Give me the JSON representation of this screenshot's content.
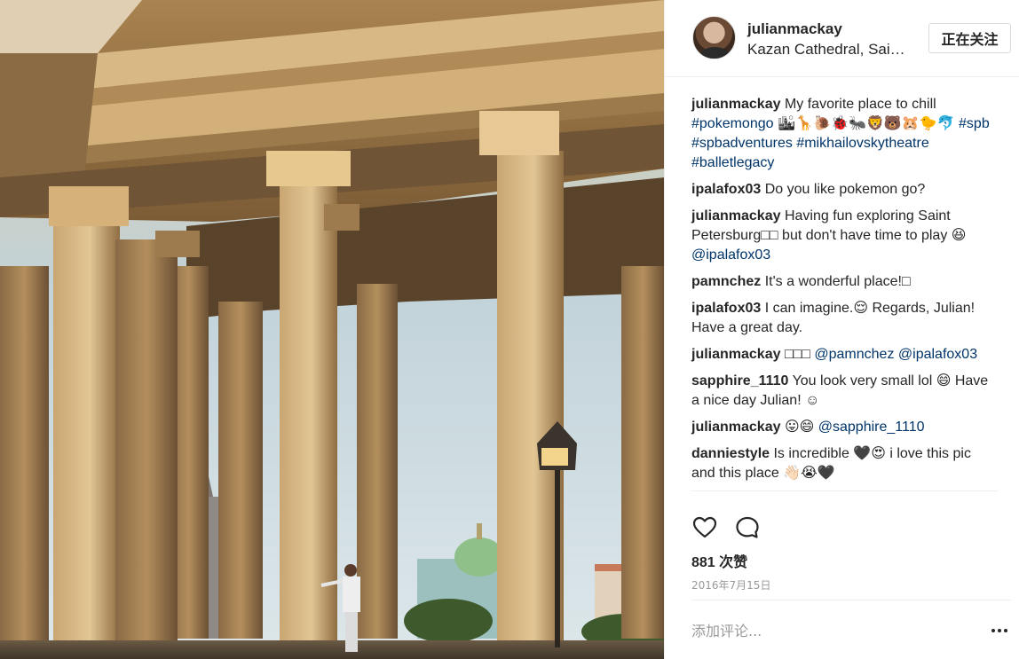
{
  "post": {
    "photo_icon": "colonnade-photo",
    "author": {
      "username": "julianmackay",
      "location": "Kazan Cathedral, Saint Petersburg",
      "avatar_icon": "profile-avatar-icon"
    },
    "follow_button_label": "正在关注",
    "comments": [
      {
        "user": "julianmackay",
        "parts": [
          {
            "t": "text",
            "v": "My favorite place to chill "
          },
          {
            "t": "tag",
            "v": "#pokemongo"
          },
          {
            "t": "text",
            "v": " 🏙🦒🐌🐞🐜🦁🐻🐹🐤🐬 "
          },
          {
            "t": "tag",
            "v": "#spb"
          },
          {
            "t": "text",
            "v": " "
          },
          {
            "t": "tag",
            "v": "#spbadventures"
          },
          {
            "t": "text",
            "v": " "
          },
          {
            "t": "tag",
            "v": "#mikhailovskytheatre"
          },
          {
            "t": "text",
            "v": " "
          },
          {
            "t": "tag",
            "v": "#balletlegacy"
          }
        ]
      },
      {
        "user": "ipalafox03",
        "parts": [
          {
            "t": "text",
            "v": "Do you like pokemon go?"
          }
        ]
      },
      {
        "user": "julianmackay",
        "parts": [
          {
            "t": "text",
            "v": "Having fun exploring Saint Petersburg□□ but don't have time to play 😆 "
          },
          {
            "t": "tag",
            "v": "@ipalafox03"
          }
        ]
      },
      {
        "user": "pamnchez",
        "parts": [
          {
            "t": "text",
            "v": "It's a wonderful place!□"
          }
        ]
      },
      {
        "user": "ipalafox03",
        "parts": [
          {
            "t": "text",
            "v": "I can imagine.😌 Regards, Julian! Have a great day."
          }
        ]
      },
      {
        "user": "julianmackay",
        "parts": [
          {
            "t": "text",
            "v": "□□□ "
          },
          {
            "t": "tag",
            "v": "@pamnchez"
          },
          {
            "t": "text",
            "v": " "
          },
          {
            "t": "tag",
            "v": "@ipalafox03"
          }
        ]
      },
      {
        "user": "sapphire_1110",
        "parts": [
          {
            "t": "text",
            "v": "You look very small lol 😄 Have a nice day Julian! ☺"
          }
        ]
      },
      {
        "user": "julianmackay",
        "parts": [
          {
            "t": "text",
            "v": "😛😄 "
          },
          {
            "t": "tag",
            "v": "@sapphire_1110"
          }
        ]
      },
      {
        "user": "danniestyle",
        "parts": [
          {
            "t": "text",
            "v": "Is incredible 🖤😍 i love this pic and this place 👋🏻😭🖤"
          }
        ]
      }
    ],
    "actions": {
      "like_icon": "heart-icon",
      "comment_icon": "comment-bubble-icon"
    },
    "likes": {
      "count": "881",
      "unit": "次赞"
    },
    "date": "2016年7月15日",
    "add_comment": {
      "placeholder": "添加评论...",
      "more_icon": "more-options-icon"
    }
  },
  "colors": {
    "hashtag": "#003569",
    "text": "#262626",
    "muted": "#999999",
    "border": "#efefef"
  }
}
